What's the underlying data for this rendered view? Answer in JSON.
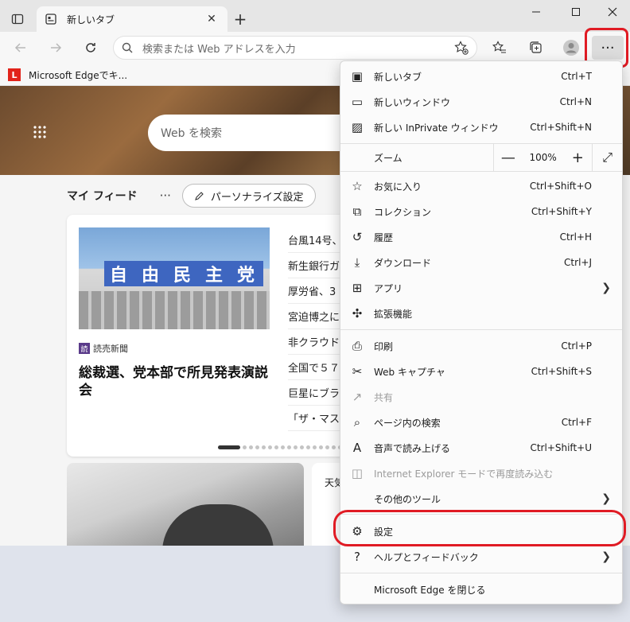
{
  "tab": {
    "title": "新しいタブ",
    "close_label": "✕",
    "new_tab_label": "+"
  },
  "address": {
    "placeholder": "検索または Web アドレスを入力"
  },
  "favorites_bar": {
    "items": [
      {
        "logo": "L",
        "label": "Microsoft Edgeでキ..."
      }
    ]
  },
  "menu_button_label": "···",
  "hero": {
    "search_placeholder": "Web を検索"
  },
  "feed": {
    "title": "マイ フィード",
    "more": "···",
    "personalize": "パーソナライズ設定"
  },
  "main_story": {
    "image_sign": [
      "自",
      "由",
      "民",
      "主",
      "党"
    ],
    "publisher_logo": "読",
    "publisher": "読売新聞",
    "headline": "総裁選、党本部で所見発表演説会"
  },
  "side_stories": [
    "台風14号、",
    "新生銀行ガ",
    "厚労省、3",
    "宮迫博之に",
    "非クラウド",
    "全国で５７",
    "巨星にブラ",
    "「ザ・マス"
  ],
  "carousel": {
    "total": 17,
    "active": 0
  },
  "weather_card": {
    "label": "天気"
  },
  "menu": {
    "items_top": [
      {
        "icon": "new-tab-icon",
        "glyph": "▣",
        "label": "新しいタブ",
        "shortcut": "Ctrl+T"
      },
      {
        "icon": "new-window-icon",
        "glyph": "▭",
        "label": "新しいウィンドウ",
        "shortcut": "Ctrl+N"
      },
      {
        "icon": "inprivate-window-icon",
        "glyph": "▨",
        "label": "新しい InPrivate ウィンドウ",
        "shortcut": "Ctrl+Shift+N"
      }
    ],
    "zoom": {
      "label": "ズーム",
      "minus": "—",
      "value": "100%",
      "plus": "+",
      "fullscreen": "⤢"
    },
    "items_mid": [
      {
        "icon": "favorites-icon",
        "glyph": "☆",
        "label": "お気に入り",
        "shortcut": "Ctrl+Shift+O"
      },
      {
        "icon": "collections-icon",
        "glyph": "⧉",
        "label": "コレクション",
        "shortcut": "Ctrl+Shift+Y"
      },
      {
        "icon": "history-icon",
        "glyph": "↺",
        "label": "履歴",
        "shortcut": "Ctrl+H"
      },
      {
        "icon": "downloads-icon",
        "glyph": "⤓",
        "label": "ダウンロード",
        "shortcut": "Ctrl+J"
      },
      {
        "icon": "apps-icon",
        "glyph": "⊞",
        "label": "アプリ",
        "shortcut": ""
      },
      {
        "icon": "extensions-icon",
        "glyph": "✣",
        "label": "拡張機能",
        "shortcut": ""
      }
    ],
    "items_tools": [
      {
        "icon": "print-icon",
        "glyph": "⎙",
        "label": "印刷",
        "shortcut": "Ctrl+P"
      },
      {
        "icon": "web-capture-icon",
        "glyph": "✂",
        "label": "Web キャプチャ",
        "shortcut": "Ctrl+Shift+S"
      },
      {
        "icon": "share-icon",
        "glyph": "↗",
        "label": "共有",
        "shortcut": ""
      },
      {
        "icon": "find-on-page-icon",
        "glyph": "⌕",
        "label": "ページ内の検索",
        "shortcut": "Ctrl+F"
      },
      {
        "icon": "read-aloud-icon",
        "glyph": "A",
        "label": "音声で読み上げる",
        "shortcut": "Ctrl+Shift+U"
      },
      {
        "icon": "ie-mode-icon",
        "glyph": "◫",
        "label": "Internet Explorer モードで再度読み込む",
        "shortcut": ""
      },
      {
        "icon": "",
        "glyph": "",
        "label": "その他のツール",
        "shortcut": ""
      }
    ],
    "settings": {
      "icon": "gear-icon",
      "glyph": "⚙",
      "label": "設定"
    },
    "help": {
      "icon": "help-icon",
      "glyph": "?",
      "label": "ヘルプとフィードバック"
    },
    "close": {
      "label": "Microsoft Edge を閉じる"
    }
  },
  "colors": {
    "highlight": "#e01b24",
    "menu_bg": "#fbfbfb",
    "accent_logo": "#e2231a"
  }
}
